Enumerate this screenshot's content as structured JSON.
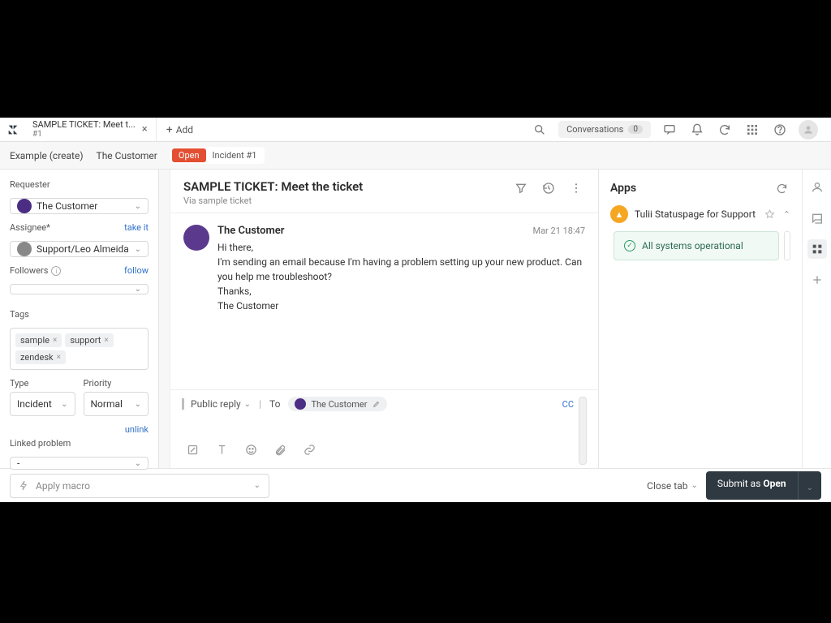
{
  "tabs": {
    "active": {
      "title": "SAMPLE TICKET: Meet t...",
      "subtitle": "#1"
    },
    "add_label": "Add"
  },
  "topbar": {
    "conversations_label": "Conversations",
    "conversations_count": "0"
  },
  "secbar": {
    "example_create": "Example (create)",
    "customer": "The Customer",
    "status": "Open",
    "incident_id": "Incident #1"
  },
  "left": {
    "requester_label": "Requester",
    "requester_value": "The Customer",
    "assignee_label": "Assignee*",
    "assignee_action": "take it",
    "assignee_value": "Support/Leo Almeida",
    "followers_label": "Followers",
    "followers_action": "follow",
    "tags_label": "Tags",
    "tags": [
      "sample",
      "support",
      "zendesk"
    ],
    "type_label": "Type",
    "type_value": "Incident",
    "priority_label": "Priority",
    "priority_value": "Normal",
    "unlink": "unlink",
    "linked_label": "Linked problem",
    "linked_value": "-"
  },
  "ticket": {
    "title": "SAMPLE TICKET: Meet the ticket",
    "via": "Via sample ticket",
    "message": {
      "author": "The Customer",
      "time": "Mar 21 18:47",
      "body": "Hi there,\nI'm sending an email because I'm having a problem setting up your new product. Can you help me troubleshoot?\nThanks,\nThe Customer"
    }
  },
  "reply": {
    "type": "Public reply",
    "to_label": "To",
    "to_value": "The Customer",
    "cc": "CC"
  },
  "apps": {
    "title": "Apps",
    "integration": "Tulii Statuspage for Support",
    "status_text": "All systems operational"
  },
  "footer": {
    "macro_placeholder": "Apply macro",
    "close_tab": "Close tab",
    "submit_prefix": "Submit as ",
    "submit_status": "Open"
  }
}
